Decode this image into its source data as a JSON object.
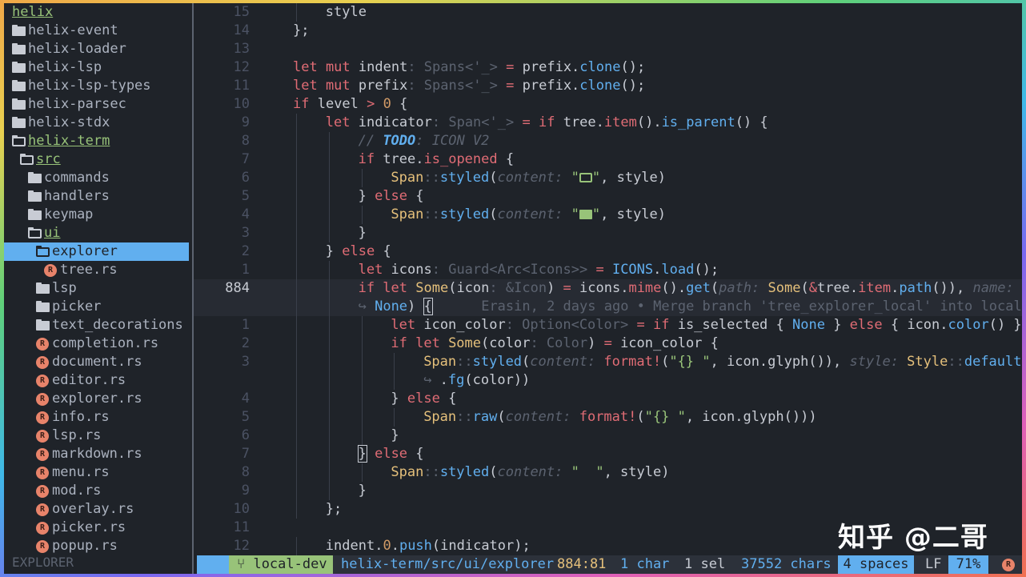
{
  "sidebar": {
    "root": "helix",
    "items": [
      {
        "label": "helix-event",
        "depth": 0,
        "kind": "dir"
      },
      {
        "label": "helix-loader",
        "depth": 0,
        "kind": "dir"
      },
      {
        "label": "helix-lsp",
        "depth": 0,
        "kind": "dir"
      },
      {
        "label": "helix-lsp-types",
        "depth": 0,
        "kind": "dir"
      },
      {
        "label": "helix-parsec",
        "depth": 0,
        "kind": "dir"
      },
      {
        "label": "helix-stdx",
        "depth": 0,
        "kind": "dir"
      },
      {
        "label": "helix-term",
        "depth": 0,
        "kind": "open"
      },
      {
        "label": "src",
        "depth": 1,
        "kind": "open"
      },
      {
        "label": "commands",
        "depth": 2,
        "kind": "dir"
      },
      {
        "label": "handlers",
        "depth": 2,
        "kind": "dir"
      },
      {
        "label": "keymap",
        "depth": 2,
        "kind": "dir"
      },
      {
        "label": "ui",
        "depth": 2,
        "kind": "open"
      },
      {
        "label": "explorer",
        "depth": 3,
        "kind": "selected"
      },
      {
        "label": "tree.rs",
        "depth": 4,
        "kind": "rust"
      },
      {
        "label": "lsp",
        "depth": 3,
        "kind": "dir"
      },
      {
        "label": "picker",
        "depth": 3,
        "kind": "dir"
      },
      {
        "label": "text_decorations",
        "depth": 3,
        "kind": "dir"
      },
      {
        "label": "completion.rs",
        "depth": 3,
        "kind": "rust"
      },
      {
        "label": "document.rs",
        "depth": 3,
        "kind": "rust"
      },
      {
        "label": "editor.rs",
        "depth": 3,
        "kind": "rust"
      },
      {
        "label": "explorer.rs",
        "depth": 3,
        "kind": "rust"
      },
      {
        "label": "info.rs",
        "depth": 3,
        "kind": "rust"
      },
      {
        "label": "lsp.rs",
        "depth": 3,
        "kind": "rust"
      },
      {
        "label": "markdown.rs",
        "depth": 3,
        "kind": "rust"
      },
      {
        "label": "menu.rs",
        "depth": 3,
        "kind": "rust"
      },
      {
        "label": "mod.rs",
        "depth": 3,
        "kind": "rust"
      },
      {
        "label": "overlay.rs",
        "depth": 3,
        "kind": "rust"
      },
      {
        "label": "picker.rs",
        "depth": 3,
        "kind": "rust"
      },
      {
        "label": "popup.rs",
        "depth": 3,
        "kind": "rust"
      }
    ],
    "footer": "EXPLORER"
  },
  "editor": {
    "line_numbers": [
      "15",
      "14",
      "13",
      "12",
      "11",
      "10",
      "9",
      "8",
      "7",
      "6",
      "5",
      "4",
      "3",
      "2",
      "1",
      "884",
      "",
      "1",
      "2",
      "3",
      "",
      "4",
      "5",
      "6",
      "7",
      "8",
      "9",
      "10",
      "11",
      "12"
    ],
    "blame": "Erasin, 2 days ago • Merge branch 'tree_explorer_local' into local…"
  },
  "status": {
    "branch": "local-dev",
    "path": "helix-term/src/ui/explorer",
    "position": "884:81",
    "chars_sel": "1 char",
    "selections": "1 sel",
    "total_chars": "37552 chars",
    "indent": "4 spaces",
    "line_ending": "LF",
    "progress": "71%"
  },
  "watermark": "知乎 @二哥",
  "colors": {
    "accent": "#61afef",
    "keyword": "#e06c75",
    "type": "#e5c07b",
    "string": "#98c379",
    "background": "#1f2329"
  }
}
